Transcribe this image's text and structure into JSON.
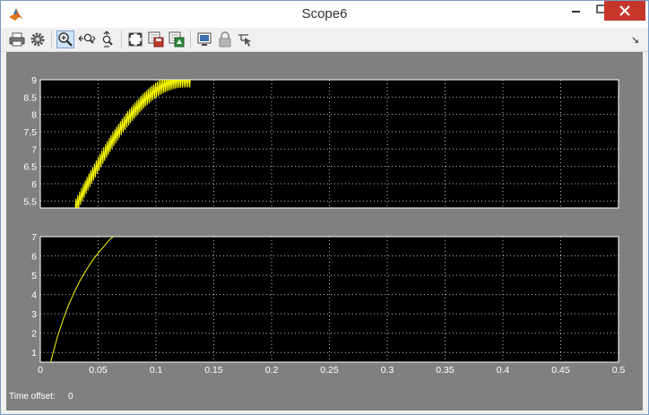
{
  "window": {
    "title": "Scope6",
    "close_color": "#c7362b"
  },
  "toolbar": {
    "buttons": [
      {
        "name": "print",
        "icon": "printer-icon"
      },
      {
        "name": "parameters",
        "icon": "gear-icon"
      },
      {
        "name": "zoom",
        "icon": "zoom-in-icon",
        "active": true
      },
      {
        "name": "zoom-x",
        "icon": "zoom-x-axis-icon"
      },
      {
        "name": "zoom-y",
        "icon": "zoom-y-axis-icon"
      },
      {
        "name": "autoscale",
        "icon": "autoscale-icon"
      },
      {
        "name": "save-axes",
        "icon": "save-axes-settings-icon"
      },
      {
        "name": "restore-axes",
        "icon": "restore-axes-settings-icon"
      },
      {
        "name": "floating-scope",
        "icon": "floating-scope-icon"
      },
      {
        "name": "lock-axes",
        "icon": "lock-icon"
      },
      {
        "name": "signal-selector",
        "icon": "signal-selector-icon"
      }
    ],
    "dock_icon": "dock-arrow-icon"
  },
  "status": {
    "time_offset_label": "Time offset:",
    "time_offset_value": "0"
  },
  "colors": {
    "plot_background": "#000000",
    "figure_background": "#808080",
    "trace": "#ffff00",
    "axes": "#ffffff"
  },
  "chart_data": [
    {
      "type": "line",
      "xlim": [
        0,
        0.5
      ],
      "ylim": [
        5.3,
        9
      ],
      "yticks": [
        "5.5",
        "6",
        "6.5",
        "7",
        "7.5",
        "8",
        "8.5",
        "9"
      ],
      "xticks": [
        "0",
        "0.05",
        "0.1",
        "0.15",
        "0.2",
        "0.25",
        "0.3",
        "0.35",
        "0.4",
        "0.45",
        "0.5"
      ],
      "show_xtick_labels": false,
      "grid": true,
      "ripple": 0.22,
      "ripple_period": 0.0016,
      "series": [
        {
          "x": [
            0.03,
            0.035,
            0.04,
            0.045,
            0.05,
            0.055,
            0.06,
            0.065,
            0.07,
            0.075,
            0.08,
            0.085,
            0.09,
            0.095,
            0.1,
            0.105,
            0.11,
            0.115,
            0.12,
            0.125,
            0.13
          ],
          "y": [
            5.3,
            5.62,
            5.95,
            6.25,
            6.55,
            6.85,
            7.12,
            7.38,
            7.62,
            7.85,
            8.05,
            8.24,
            8.42,
            8.57,
            8.7,
            8.81,
            8.89,
            8.95,
            8.99,
            9.0,
            9.0
          ],
          "color": "#ffff00"
        }
      ]
    },
    {
      "type": "line",
      "xlim": [
        0,
        0.5
      ],
      "ylim": [
        0.5,
        7
      ],
      "yticks": [
        "1",
        "2",
        "3",
        "4",
        "5",
        "6",
        "7"
      ],
      "xticks": [
        "0",
        "0.05",
        "0.1",
        "0.15",
        "0.2",
        "0.25",
        "0.3",
        "0.35",
        "0.4",
        "0.45",
        "0.5"
      ],
      "show_xtick_labels": true,
      "grid": true,
      "series": [
        {
          "x": [
            0.009,
            0.012,
            0.015,
            0.02,
            0.025,
            0.03,
            0.035,
            0.04,
            0.045,
            0.05,
            0.055,
            0.06,
            0.063
          ],
          "y": [
            0.5,
            1.2,
            1.85,
            2.75,
            3.55,
            4.2,
            4.8,
            5.3,
            5.75,
            6.15,
            6.5,
            6.85,
            7.0
          ],
          "color": "#ffff00"
        }
      ]
    }
  ]
}
